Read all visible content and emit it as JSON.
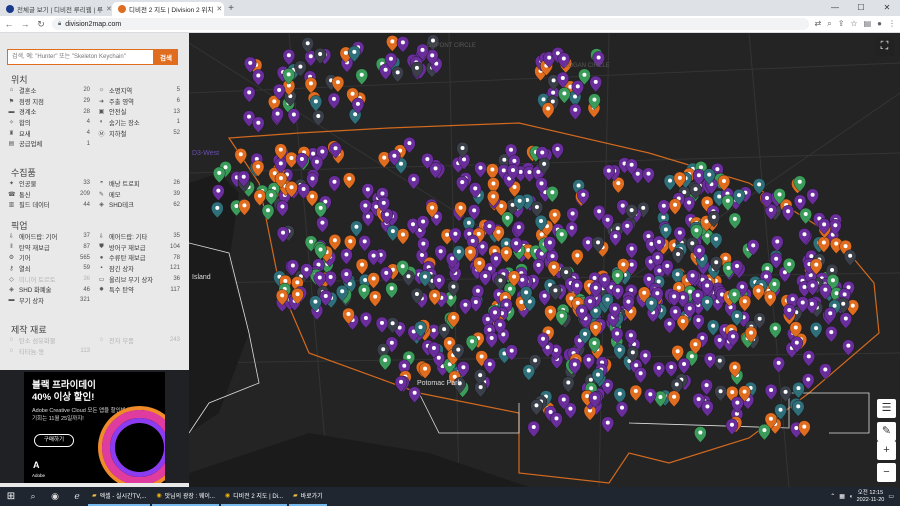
{
  "browser": {
    "tabs": [
      {
        "title": "전체글 보기 | 디비전 루리웹 | 루",
        "active": false,
        "color": "#1a3a8c"
      },
      {
        "title": "디비전 2 지도 | Division 2 위치",
        "active": true,
        "color": "#e06d1f"
      }
    ],
    "tab_labels_icon": [
      "tab-favicon-ruliweb",
      "tab-favicon-division2map"
    ],
    "new_tab": "+",
    "url": "division2map.com",
    "window_controls": [
      "—",
      "☐",
      "✕"
    ]
  },
  "sidebar": {
    "search_placeholder": "검색, 예: \"Hunter\" 또는 \"Skeleton Keychain\"",
    "search_button": "검색",
    "sections": [
      {
        "title": "위치",
        "items": [
          {
            "label": "결혼소",
            "count": "20",
            "icon": "house-icon"
          },
          {
            "label": "소명지역",
            "count": "5",
            "icon": "sun-icon"
          },
          {
            "label": "점령 지점",
            "count": "29",
            "icon": "flag-icon"
          },
          {
            "label": "주출 영역",
            "count": "6",
            "icon": "arrow-icon"
          },
          {
            "label": "경계소",
            "count": "28",
            "icon": "barrier-icon"
          },
          {
            "label": "안전실",
            "count": "13",
            "icon": "safe-icon"
          },
          {
            "label": "합의",
            "count": "4",
            "icon": "handshake-icon"
          },
          {
            "label": "숨기는 장소",
            "count": "1",
            "icon": "hide-icon"
          },
          {
            "label": "요새",
            "count": "4",
            "icon": "fort-icon"
          },
          {
            "label": "지하철",
            "count": "52",
            "icon": "subway-icon"
          },
          {
            "label": "공급업체",
            "count": "1",
            "icon": "vendor-icon"
          }
        ]
      },
      {
        "title": "수집품",
        "items": [
          {
            "label": "인공물",
            "count": "33",
            "icon": "artifact-icon"
          },
          {
            "label": "배낭 트로피",
            "count": "26",
            "icon": "backpack-icon"
          },
          {
            "label": "통신",
            "count": "209",
            "icon": "radio-icon"
          },
          {
            "label": "메모",
            "count": "39",
            "icon": "note-icon"
          },
          {
            "label": "필드 데이터",
            "count": "44",
            "icon": "data-icon"
          },
          {
            "label": "SHD테크",
            "count": "62",
            "icon": "shd-icon"
          }
        ]
      },
      {
        "title": "픽업",
        "items": [
          {
            "label": "에어드랍: 기어",
            "count": "37",
            "icon": "airdrop-icon"
          },
          {
            "label": "에어드랍: 기타",
            "count": "35",
            "icon": "airdrop-icon"
          },
          {
            "label": "탄약 재보급",
            "count": "87",
            "icon": "ammo-icon"
          },
          {
            "label": "방어구 재보급",
            "count": "104",
            "icon": "armor-icon"
          },
          {
            "label": "기어",
            "count": "565",
            "icon": "gear-icon"
          },
          {
            "label": "수류탄 재보급",
            "count": "78",
            "icon": "grenade-icon"
          },
          {
            "label": "열쇠",
            "count": "59",
            "icon": "key-icon"
          },
          {
            "label": "잠긴 상자",
            "count": "121",
            "icon": "lock-icon"
          },
          {
            "label": "미니어 토르토",
            "count": "36",
            "icon": "mini-icon",
            "dim": true
          },
          {
            "label": "올리브 무기 상자",
            "count": "36",
            "icon": "crate-icon"
          },
          {
            "label": "SHD 화폐술",
            "count": "46",
            "icon": "shd-icon"
          },
          {
            "label": "특수 탄약",
            "count": "117",
            "icon": "special-ammo-icon"
          },
          {
            "label": "무기 상자",
            "count": "321",
            "icon": "weapon-crate-icon"
          }
        ]
      },
      {
        "title": "제작 재료",
        "items": [
          {
            "label": "탄소 섬유화물",
            "count": "",
            "icon": "carbon-icon",
            "dim": true
          },
          {
            "label": "전자 부품",
            "count": "243",
            "icon": "electronic-icon",
            "dim": true
          },
          {
            "label": "티타늄·동",
            "count": "113",
            "icon": "titanium-icon",
            "dim": true
          }
        ]
      }
    ],
    "collapse_glyph": "◀"
  },
  "ad": {
    "headline_1": "블랙 프라이데이",
    "headline_2": "40% 이상 할인!",
    "body_1": "Adobe Creative Cloud 모든 앱을 할인받으세요.",
    "body_2": "기회는 11월 25일까지!",
    "button": "구매하기",
    "brand": "Adobe"
  },
  "map": {
    "labels": [
      "D3-West",
      "Island",
      "Potomac Park"
    ],
    "faint_labels": [
      "DUPONT CIRCLE",
      "LOGAN CIRCLE"
    ],
    "colors": {
      "purple": "#6a2e9c",
      "orange": "#e06d1f",
      "green": "#3b9b5a",
      "teal": "#2f6f7a",
      "gray": "#3a3f4a"
    },
    "controls": {
      "fullscreen": "⛶",
      "layers": "☰",
      "edit": "✎",
      "zoom_in": "+",
      "zoom_out": "−"
    }
  },
  "taskbar": {
    "start": "⊞",
    "apps": [
      {
        "label": "엑셀 - 실시간TV,...",
        "icon": "folder-icon"
      },
      {
        "label": "맛님의 광장 : 웨이...",
        "icon": "chrome-icon"
      },
      {
        "label": "디비전 2 지도 | Di...",
        "icon": "chrome-icon"
      },
      {
        "label": "바로가기",
        "icon": "folder-icon"
      }
    ],
    "time": "오전 12:15",
    "date": "2022-11-20"
  }
}
